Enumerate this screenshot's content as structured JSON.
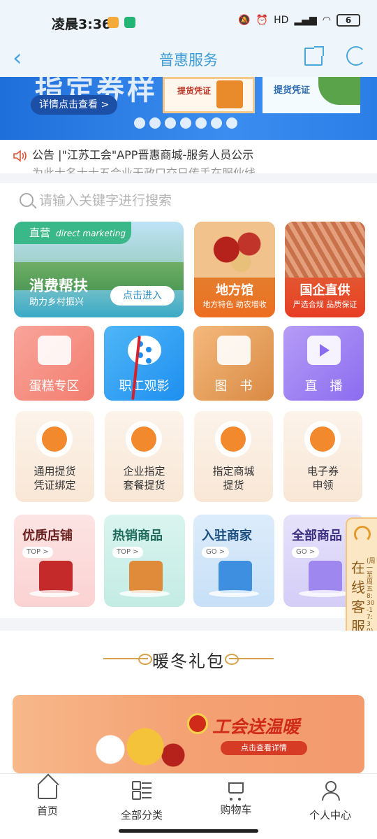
{
  "status_bar": {
    "time": "凌晨3:36",
    "battery": "6",
    "network": "HD"
  },
  "nav": {
    "title": "普惠服务"
  },
  "banner": {
    "big_text": "指定券样",
    "detail_label": "详情点击查看 >",
    "card1_title": "提货凭证",
    "card2_title": "提货凭证",
    "dot_count": 7
  },
  "notice": {
    "line1": "公告 |\"江苏工会\"APP晋惠商城-服务人员公示",
    "line2": "为此士名士士五会业天政口交日传手在服伙线"
  },
  "search": {
    "placeholder": "请输入关键字进行搜索"
  },
  "features": {
    "poverty": {
      "tag": "直营",
      "tag_en": "direct marketing",
      "name": "消费帮扶",
      "sub": "助力乡村振兴",
      "enter": "点击进入"
    },
    "local": {
      "name": "地方馆",
      "sub": "地方特色 助农增收"
    },
    "soe": {
      "name": "国企直供",
      "sub": "严选合规 品质保证"
    }
  },
  "categories": [
    {
      "label": "蛋糕专区"
    },
    {
      "label": "职工观影"
    },
    {
      "label": "图　书"
    },
    {
      "label": "直　播"
    }
  ],
  "services": [
    {
      "line1": "通用提货",
      "line2": "凭证绑定"
    },
    {
      "line1": "企业指定",
      "line2": "套餐提货"
    },
    {
      "line1": "指定商城",
      "line2": "提货"
    },
    {
      "line1": "电子券",
      "line2": "申领"
    }
  ],
  "shops": [
    {
      "name": "优质店铺",
      "tag": "TOP >"
    },
    {
      "name": "热销商品",
      "tag": "TOP >"
    },
    {
      "name": "入驻商家",
      "tag": "GO >"
    },
    {
      "name": "全部商品",
      "tag": "GO >"
    }
  ],
  "customer_service": {
    "label": "在线客服",
    "hours": "(周一至周五 8:30-17:30)"
  },
  "winter": {
    "heading": "暖冬礼包",
    "slogan": "工会送温暖",
    "more": "点击查看详情"
  },
  "tabbar": [
    {
      "label": "首页",
      "icon": "home-icon"
    },
    {
      "label": "全部分类",
      "icon": "category-icon"
    },
    {
      "label": "购物车",
      "icon": "cart-icon"
    },
    {
      "label": "个人中心",
      "icon": "user-icon"
    }
  ],
  "colors": {
    "accent": "#3e9cd6",
    "orange": "#f2892c",
    "red": "#d02a1a"
  }
}
